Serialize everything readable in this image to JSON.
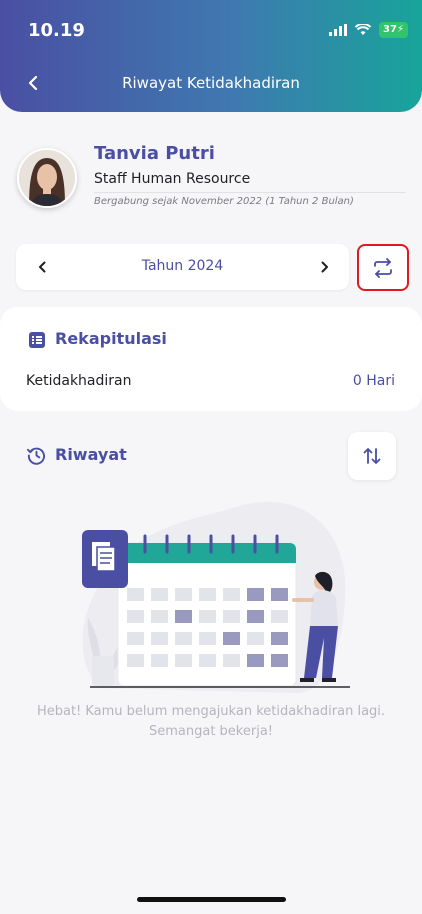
{
  "status": {
    "time": "10.19",
    "battery": "37"
  },
  "header": {
    "title": "Riwayat Ketidakhadiran"
  },
  "profile": {
    "name": "Tanvia Putri",
    "role": "Staff Human Resource",
    "joined": "Bergabung sejak November 2022 (1 Tahun 2 Bulan)"
  },
  "year_selector": {
    "label": "Tahun 2024"
  },
  "recap": {
    "title": "Rekapitulasi",
    "label": "Ketidakhadiran",
    "value": "0 Hari"
  },
  "history": {
    "title": "Riwayat"
  },
  "empty": {
    "message": "Hebat! Kamu belum mengajukan ketidakhadiran lagi. Semangat bekerja!"
  },
  "colors": {
    "primary": "#4a4fa3",
    "accent_teal": "#18a49a",
    "highlight_red": "#e0191e",
    "muted_text": "#b5b5be"
  },
  "icons": {
    "back": "chevron-left-icon",
    "year_prev": "chevron-left-icon",
    "year_next": "chevron-right-icon",
    "swap": "swap-arrows-icon",
    "recap": "list-doc-icon",
    "history": "history-clock-icon",
    "sort": "sort-arrows-icon"
  }
}
